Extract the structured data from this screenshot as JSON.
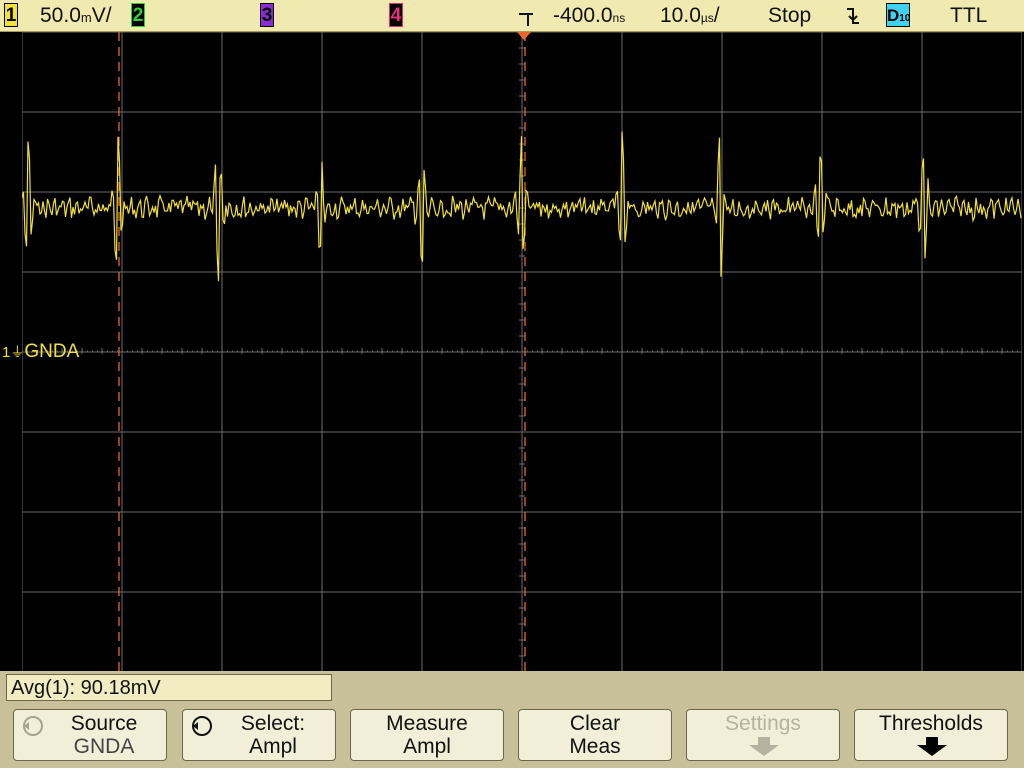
{
  "topbar": {
    "ch1": {
      "label": "1",
      "scale": "50.0",
      "unit_prefix": "m",
      "unit": "V",
      "suffix": "/"
    },
    "ch2": {
      "label": "2"
    },
    "ch3": {
      "label": "3"
    },
    "ch4": {
      "label": "4"
    },
    "trigger_delay": "-400.0",
    "delay_unit": "ns",
    "timebase": "10.0",
    "timebase_unit": "µs",
    "timebase_suffix": "/",
    "run_state": "Stop",
    "trigger_slope_icon": "falling-edge-icon",
    "digital_label": "D",
    "digital_sub": "10",
    "threshold": "TTL"
  },
  "channel1_marker": {
    "label": "1",
    "text": "GNDA"
  },
  "measurement": {
    "text": "Avg(1): 90.18mV"
  },
  "softkeys": [
    {
      "line1": "Source",
      "line2": "GNDA",
      "enabled": true
    },
    {
      "line1": "Select:",
      "line2": "Ampl",
      "enabled": true
    },
    {
      "line1": "Measure",
      "line2": "Ampl",
      "enabled": true
    },
    {
      "line1": "Clear",
      "line2": "Meas",
      "enabled": true
    },
    {
      "line1": "Settings",
      "line2": "",
      "enabled": false
    },
    {
      "line1": "Thresholds",
      "line2": "",
      "enabled": true
    }
  ],
  "colors": {
    "ch1": "#f2e13a",
    "ch2": "#2fcf35",
    "ch3": "#8a2bd6",
    "ch4": "#e8307a",
    "digital": "#3fd3f2",
    "cursor": "#e8692a",
    "grid": "#6b6b6b"
  }
}
